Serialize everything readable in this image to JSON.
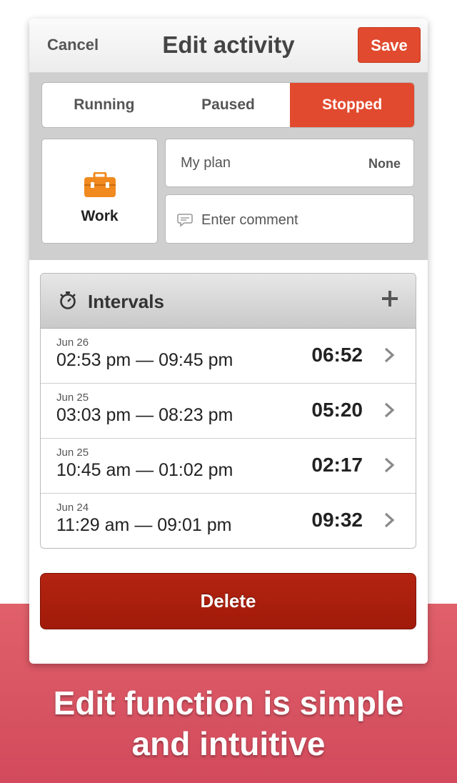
{
  "navbar": {
    "cancel_label": "Cancel",
    "title": "Edit activity",
    "save_label": "Save"
  },
  "state_segments": [
    {
      "label": "Running",
      "active": false
    },
    {
      "label": "Paused",
      "active": false
    },
    {
      "label": "Stopped",
      "active": true
    }
  ],
  "category": {
    "label": "Work",
    "icon": "briefcase-icon",
    "icon_color": "#f08a1e"
  },
  "plan": {
    "label": "My plan",
    "value": "None"
  },
  "comment": {
    "placeholder": "Enter comment",
    "value": "",
    "icon": "speech-bubble-icon"
  },
  "intervals": {
    "title": "Intervals",
    "header_icon": "stopwatch-icon",
    "add_icon": "plus-icon",
    "rows": [
      {
        "date": "Jun 26",
        "range": "02:53 pm — 09:45 pm",
        "duration": "06:52"
      },
      {
        "date": "Jun 25",
        "range": "03:03 pm — 08:23 pm",
        "duration": "05:20"
      },
      {
        "date": "Jun 25",
        "range": "10:45 am — 01:02 pm",
        "duration": "02:17"
      },
      {
        "date": "Jun 24",
        "range": "11:29 am — 09:01 pm",
        "duration": "09:32"
      }
    ]
  },
  "delete_label": "Delete",
  "caption": {
    "line1": "Edit function is simple",
    "line2": "and intuitive"
  },
  "colors": {
    "accent": "#e14a2e",
    "delete": "#a81e0c",
    "banner": "#d9535f"
  }
}
